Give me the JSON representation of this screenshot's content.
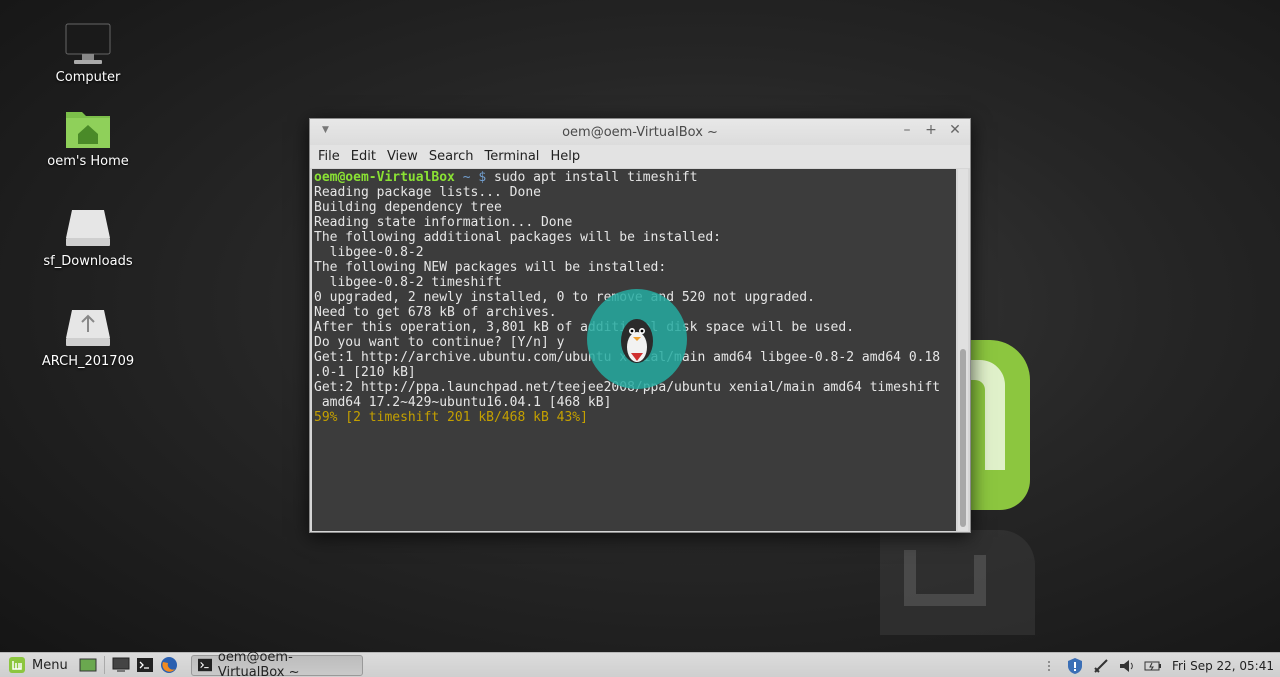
{
  "desktop": {
    "icons": [
      {
        "label": "Computer"
      },
      {
        "label": "oem's Home"
      },
      {
        "label": "sf_Downloads"
      },
      {
        "label": "ARCH_201709"
      }
    ]
  },
  "terminal": {
    "title": "oem@oem-VirtualBox ~",
    "menu": [
      "File",
      "Edit",
      "View",
      "Search",
      "Terminal",
      "Help"
    ],
    "prompt_user": "oem@oem-VirtualBox",
    "prompt_path": " ~ $",
    "command": " sudo apt install timeshift",
    "lines": [
      "Reading package lists... Done",
      "Building dependency tree",
      "Reading state information... Done",
      "The following additional packages will be installed:",
      "  libgee-0.8-2",
      "The following NEW packages will be installed:",
      "  libgee-0.8-2 timeshift",
      "0 upgraded, 2 newly installed, 0 to remove and 520 not upgraded.",
      "Need to get 678 kB of archives.",
      "After this operation, 3,801 kB of additional disk space will be used.",
      "Do you want to continue? [Y/n] y",
      "Get:1 http://archive.ubuntu.com/ubuntu xenial/main amd64 libgee-0.8-2 amd64 0.18",
      ".0-1 [210 kB]",
      "Get:2 http://ppa.launchpad.net/teejee2008/ppa/ubuntu xenial/main amd64 timeshift",
      " amd64 17.2~429~ubuntu16.04.1 [468 kB]"
    ],
    "progress_line": "59% [2 timeshift 201 kB/468 kB 43%]"
  },
  "panel": {
    "menu_label": "Menu",
    "task_label": "oem@oem-VirtualBox ~",
    "clock": "Fri Sep 22, 05:41"
  },
  "colors": {
    "prompt_user": "#8ae234",
    "prompt_path": "#729fcf",
    "progress": "#c4a000",
    "mint_green": "#8cc63f"
  }
}
